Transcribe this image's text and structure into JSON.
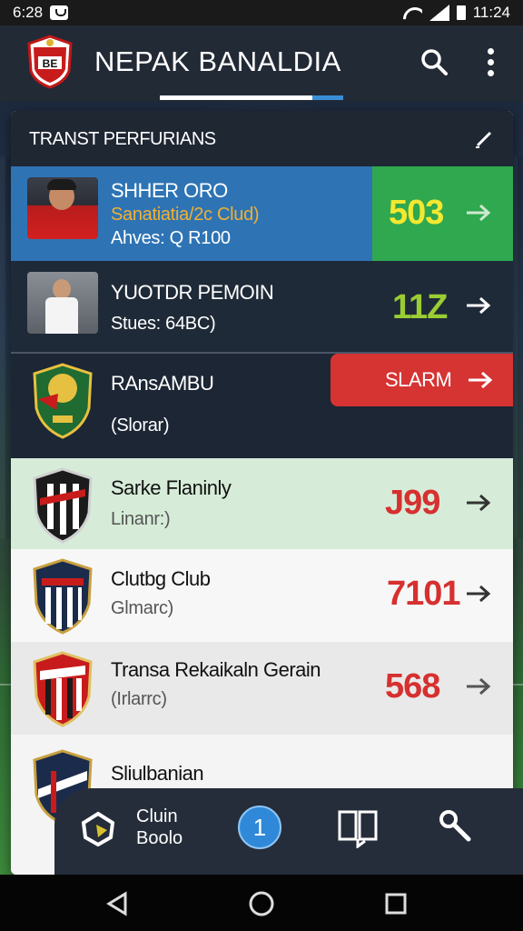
{
  "status_bar": {
    "time_left": "6:28",
    "time_right": "11:24"
  },
  "app_bar": {
    "title": "NEPAK BANALDIA",
    "logo_text": "BE"
  },
  "card": {
    "title": "TRANST PERFURIANS",
    "rows": [
      {
        "name": "SHHER ORO",
        "line1": "Sanatiatia/2c Clud)",
        "line2": "Ahves: Q R100",
        "value": "503",
        "accent": "#f0e030"
      },
      {
        "name": "YUOTDR PEMOIN",
        "line1": "",
        "line2": "Stues: 64BC)",
        "value": "11Z",
        "accent": "#9acd32"
      },
      {
        "name": "RAnsAMBU",
        "line1": "",
        "line2": "(Slorar)",
        "button": "SLARM"
      },
      {
        "name": "Sarke Flaninly",
        "line1": "Linanr:)",
        "value": "J99",
        "accent": "#d83030"
      },
      {
        "name": "Clutbg Club",
        "line1": "Glmarc)",
        "value": "7101",
        "accent": "#d83030"
      },
      {
        "name": "Transa Rekaikaln Gerain",
        "line1": "(Irlarrc)",
        "value": "568",
        "accent": "#d83030"
      },
      {
        "name": "Sliulbanian",
        "line1": ""
      }
    ]
  },
  "bottom_nav": {
    "label_line1": "Cluin",
    "label_line2": "Boolo",
    "badge": "1"
  }
}
